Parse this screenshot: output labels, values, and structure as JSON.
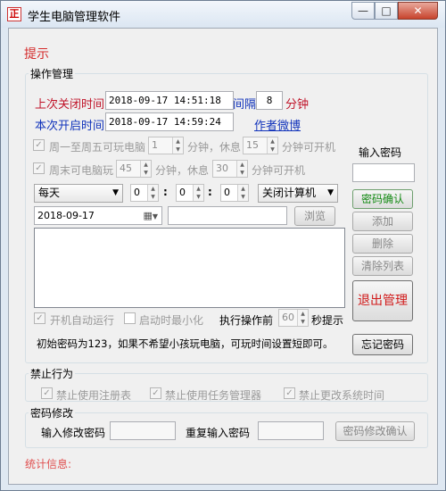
{
  "window": {
    "title": "学生电脑管理软件",
    "app_icon_char": "正",
    "min_glyph": "—",
    "max_glyph": "□",
    "close_glyph": "✕"
  },
  "tip": "提示",
  "ops": {
    "group_label": "操作管理",
    "last_close_label": "上次关闭时间",
    "last_close_value": "2018-09-17  14:51:18",
    "interval_label": "间隔",
    "interval_value": "8",
    "interval_unit": "分钟",
    "this_open_label": "本次开启时间",
    "this_open_value": "2018-09-17  14:59:24",
    "author_link": "作者微博",
    "weekday_label": "周一至周五可玩电脑",
    "weekday_play": "1",
    "weekday_mid": "分钟，休息",
    "weekday_rest": "15",
    "weekday_tail": "分钟可开机",
    "weekend_label": "周末可电脑玩",
    "weekend_play": "45",
    "weekend_mid": "分钟，休息",
    "weekend_rest": "30",
    "weekend_tail": "分钟可开机",
    "schedule_freq": "每天",
    "hour": "0",
    "minute": "0",
    "second": "0",
    "action": "关闭计算机",
    "date": "2018-09-17",
    "browse_label": "浏览",
    "autostart_label": "开机自动运行",
    "minimize_label": "启动时最小化",
    "before_label": "执行操作前",
    "before_value": "60",
    "before_unit": "秒提示",
    "info_text": "初始密码为123，如果不希望小孩玩电脑，可玩时间设置短即可。"
  },
  "right": {
    "pwd_label": "输入密码",
    "confirm": "密码确认",
    "add": "添加",
    "delete": "删除",
    "clear": "清除列表",
    "exit": "退出管理",
    "forgot": "忘记密码"
  },
  "forbid": {
    "group_label": "禁止行为",
    "registry": "禁止使用注册表",
    "taskmgr": "禁止使用任务管理器",
    "systime": "禁止更改系统时间"
  },
  "pwdchange": {
    "group_label": "密码修改",
    "input_label": "输入修改密码",
    "repeat_label": "重复输入密码",
    "confirm": "密码修改确认"
  },
  "stats": "统计信息:",
  "glyphs": {
    "check": "✓",
    "dropdown": "▼",
    "spin_up": "▲",
    "spin_down": "▼",
    "calendar": "▦"
  }
}
